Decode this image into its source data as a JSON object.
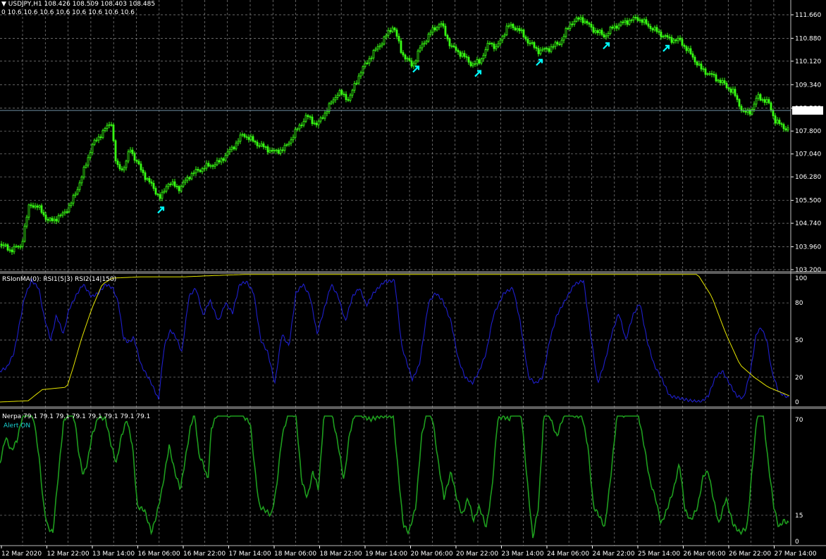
{
  "colors": {
    "background": "#000000",
    "grid": "#8a8a8a",
    "bull_candle": "#39ff14",
    "bear_candle": "#39ff14",
    "arrow": "#00ffff",
    "rsi1": "#1f1fcc",
    "rsi2": "#e6e600",
    "nerpa": "#1e9e1e",
    "price_line": "#6f8fa5",
    "axis_text": "#ffffff"
  },
  "main": {
    "symbol_header": "USDJPY,H1  108.426 108.509 108.403 108.485",
    "ma_values": "0 10.6 10.6 10.6 10.6 10.6 10.6 10.6 10.6",
    "current_price": "108.485",
    "price_ticks": [
      "111.660",
      "110.880",
      "110.120",
      "109.340",
      "108.560",
      "107.800",
      "107.040",
      "106.280",
      "105.500",
      "104.740",
      "103.960",
      "103.200"
    ]
  },
  "rsi_panel": {
    "label": "RSIonMA(0): RSI1(5|3) RSI2(14|150)",
    "ticks": [
      "100",
      "80",
      "50",
      "20",
      "0"
    ]
  },
  "nerpa_panel": {
    "label": "Nerpa 79.1 79.1 79.1 79.1 79.1 79.1 79.1 79.1",
    "alert": "Alert ON",
    "ticks": [
      "70",
      "15",
      "0"
    ]
  },
  "time_axis": {
    "labels": [
      "12 Mar 2020",
      "12 Mar 22:00",
      "13 Mar 14:00",
      "16 Mar 06:00",
      "16 Mar 22:00",
      "17 Mar 14:00",
      "18 Mar 06:00",
      "18 Mar 22:00",
      "19 Mar 14:00",
      "20 Mar 06:00",
      "20 Mar 22:00",
      "23 Mar 14:00",
      "24 Mar 06:00",
      "24 Mar 22:00",
      "25 Mar 14:00",
      "26 Mar 06:00",
      "26 Mar 22:00",
      "27 Mar 14:00"
    ]
  },
  "chart_data": {
    "type": "line",
    "title": "USDJPY,H1",
    "price_path_anchors": [
      [
        0,
        104.05
      ],
      [
        15,
        103.85
      ],
      [
        30,
        104.0
      ],
      [
        42,
        105.4
      ],
      [
        58,
        105.2
      ],
      [
        68,
        104.8
      ],
      [
        85,
        104.95
      ],
      [
        100,
        105.35
      ],
      [
        115,
        106.2
      ],
      [
        130,
        107.3
      ],
      [
        145,
        107.75
      ],
      [
        158,
        108.1
      ],
      [
        165,
        106.6
      ],
      [
        175,
        106.55
      ],
      [
        185,
        107.2
      ],
      [
        200,
        106.5
      ],
      [
        215,
        106.0
      ],
      [
        228,
        105.55
      ],
      [
        238,
        106.1
      ],
      [
        255,
        105.9
      ],
      [
        270,
        106.35
      ],
      [
        290,
        106.6
      ],
      [
        310,
        106.75
      ],
      [
        330,
        107.25
      ],
      [
        345,
        107.7
      ],
      [
        360,
        107.45
      ],
      [
        375,
        107.25
      ],
      [
        390,
        107.1
      ],
      [
        405,
        107.25
      ],
      [
        420,
        107.8
      ],
      [
        435,
        108.3
      ],
      [
        450,
        108.0
      ],
      [
        465,
        108.55
      ],
      [
        480,
        109.1
      ],
      [
        495,
        108.85
      ],
      [
        510,
        109.7
      ],
      [
        525,
        110.25
      ],
      [
        540,
        110.7
      ],
      [
        558,
        111.3
      ],
      [
        570,
        110.4
      ],
      [
        585,
        109.95
      ],
      [
        595,
        110.5
      ],
      [
        610,
        111.05
      ],
      [
        625,
        111.4
      ],
      [
        640,
        110.6
      ],
      [
        655,
        110.35
      ],
      [
        670,
        110.0
      ],
      [
        680,
        110.1
      ],
      [
        695,
        110.75
      ],
      [
        705,
        110.55
      ],
      [
        720,
        111.3
      ],
      [
        735,
        111.2
      ],
      [
        750,
        110.75
      ],
      [
        765,
        110.45
      ],
      [
        780,
        110.55
      ],
      [
        795,
        110.75
      ],
      [
        810,
        111.4
      ],
      [
        825,
        111.55
      ],
      [
        840,
        111.2
      ],
      [
        858,
        110.95
      ],
      [
        870,
        111.25
      ],
      [
        890,
        111.45
      ],
      [
        905,
        111.55
      ],
      [
        920,
        111.3
      ],
      [
        935,
        111.05
      ],
      [
        950,
        110.85
      ],
      [
        965,
        110.8
      ],
      [
        980,
        110.35
      ],
      [
        995,
        109.85
      ],
      [
        1010,
        109.65
      ],
      [
        1025,
        109.4
      ],
      [
        1040,
        109.1
      ],
      [
        1055,
        108.4
      ],
      [
        1065,
        108.45
      ],
      [
        1075,
        108.95
      ],
      [
        1090,
        108.75
      ],
      [
        1100,
        108.15
      ],
      [
        1110,
        107.95
      ],
      [
        1120,
        107.85
      ]
    ],
    "signal_arrows_x": [
      228,
      590,
      678,
      765,
      860,
      945
    ],
    "rsi1_anchors": [
      [
        0,
        25
      ],
      [
        10,
        28
      ],
      [
        20,
        40
      ],
      [
        35,
        85
      ],
      [
        45,
        98
      ],
      [
        55,
        92
      ],
      [
        62,
        70
      ],
      [
        72,
        50
      ],
      [
        80,
        70
      ],
      [
        90,
        55
      ],
      [
        98,
        75
      ],
      [
        110,
        88
      ],
      [
        118,
        95
      ],
      [
        130,
        85
      ],
      [
        140,
        88
      ],
      [
        150,
        95
      ],
      [
        160,
        92
      ],
      [
        168,
        80
      ],
      [
        175,
        52
      ],
      [
        182,
        48
      ],
      [
        190,
        52
      ],
      [
        200,
        30
      ],
      [
        215,
        15
      ],
      [
        225,
        2
      ],
      [
        233,
        45
      ],
      [
        242,
        58
      ],
      [
        250,
        52
      ],
      [
        258,
        40
      ],
      [
        268,
        85
      ],
      [
        278,
        92
      ],
      [
        288,
        70
      ],
      [
        298,
        82
      ],
      [
        310,
        65
      ],
      [
        320,
        80
      ],
      [
        330,
        72
      ],
      [
        340,
        95
      ],
      [
        350,
        97
      ],
      [
        360,
        88
      ],
      [
        370,
        50
      ],
      [
        380,
        40
      ],
      [
        390,
        15
      ],
      [
        400,
        55
      ],
      [
        410,
        45
      ],
      [
        420,
        88
      ],
      [
        430,
        95
      ],
      [
        440,
        85
      ],
      [
        450,
        55
      ],
      [
        460,
        75
      ],
      [
        470,
        95
      ],
      [
        480,
        85
      ],
      [
        490,
        65
      ],
      [
        500,
        85
      ],
      [
        510,
        92
      ],
      [
        520,
        78
      ],
      [
        530,
        88
      ],
      [
        545,
        97
      ],
      [
        560,
        98
      ],
      [
        570,
        45
      ],
      [
        585,
        18
      ],
      [
        595,
        30
      ],
      [
        608,
        80
      ],
      [
        618,
        88
      ],
      [
        628,
        82
      ],
      [
        640,
        65
      ],
      [
        650,
        35
      ],
      [
        660,
        20
      ],
      [
        670,
        15
      ],
      [
        680,
        25
      ],
      [
        690,
        40
      ],
      [
        700,
        70
      ],
      [
        715,
        88
      ],
      [
        728,
        92
      ],
      [
        738,
        65
      ],
      [
        750,
        20
      ],
      [
        760,
        15
      ],
      [
        770,
        20
      ],
      [
        780,
        50
      ],
      [
        790,
        70
      ],
      [
        800,
        80
      ],
      [
        815,
        95
      ],
      [
        828,
        98
      ],
      [
        838,
        55
      ],
      [
        848,
        15
      ],
      [
        858,
        32
      ],
      [
        868,
        55
      ],
      [
        878,
        72
      ],
      [
        888,
        50
      ],
      [
        898,
        70
      ],
      [
        908,
        80
      ],
      [
        918,
        50
      ],
      [
        928,
        30
      ],
      [
        938,
        20
      ],
      [
        950,
        5
      ],
      [
        965,
        3
      ],
      [
        980,
        1
      ],
      [
        995,
        0
      ],
      [
        1005,
        5
      ],
      [
        1015,
        20
      ],
      [
        1025,
        25
      ],
      [
        1035,
        15
      ],
      [
        1045,
        5
      ],
      [
        1055,
        3
      ],
      [
        1065,
        25
      ],
      [
        1073,
        55
      ],
      [
        1080,
        60
      ],
      [
        1088,
        50
      ],
      [
        1095,
        25
      ],
      [
        1105,
        8
      ],
      [
        1120,
        3
      ]
    ],
    "rsi2_anchors": [
      [
        0,
        0
      ],
      [
        40,
        1
      ],
      [
        60,
        10
      ],
      [
        95,
        12
      ],
      [
        105,
        30
      ],
      [
        115,
        50
      ],
      [
        130,
        75
      ],
      [
        145,
        95
      ],
      [
        160,
        100
      ],
      [
        200,
        101
      ],
      [
        260,
        101
      ],
      [
        300,
        102
      ],
      [
        350,
        103
      ],
      [
        990,
        103
      ],
      [
        1010,
        85
      ],
      [
        1030,
        55
      ],
      [
        1050,
        30
      ],
      [
        1070,
        20
      ],
      [
        1090,
        12
      ],
      [
        1120,
        5
      ]
    ],
    "nerpa_anchors": [
      [
        0,
        45
      ],
      [
        8,
        60
      ],
      [
        16,
        52
      ],
      [
        24,
        58
      ],
      [
        32,
        72
      ],
      [
        40,
        75
      ],
      [
        48,
        70
      ],
      [
        55,
        50
      ],
      [
        62,
        20
      ],
      [
        68,
        8
      ],
      [
        75,
        5
      ],
      [
        82,
        35
      ],
      [
        90,
        68
      ],
      [
        98,
        75
      ],
      [
        106,
        70
      ],
      [
        112,
        50
      ],
      [
        118,
        38
      ],
      [
        124,
        45
      ],
      [
        130,
        60
      ],
      [
        140,
        72
      ],
      [
        150,
        70
      ],
      [
        158,
        55
      ],
      [
        165,
        45
      ],
      [
        172,
        60
      ],
      [
        180,
        70
      ],
      [
        188,
        55
      ],
      [
        195,
        20
      ],
      [
        205,
        18
      ],
      [
        215,
        5
      ],
      [
        222,
        15
      ],
      [
        230,
        30
      ],
      [
        240,
        55
      ],
      [
        248,
        40
      ],
      [
        256,
        30
      ],
      [
        262,
        45
      ],
      [
        270,
        65
      ],
      [
        276,
        75
      ],
      [
        282,
        50
      ],
      [
        288,
        45
      ],
      [
        295,
        35
      ],
      [
        300,
        65
      ],
      [
        310,
        75
      ],
      [
        318,
        75
      ],
      [
        325,
        72
      ],
      [
        335,
        76
      ],
      [
        345,
        72
      ],
      [
        355,
        68
      ],
      [
        362,
        40
      ],
      [
        368,
        20
      ],
      [
        376,
        18
      ],
      [
        385,
        15
      ],
      [
        392,
        30
      ],
      [
        400,
        60
      ],
      [
        410,
        75
      ],
      [
        420,
        72
      ],
      [
        428,
        35
      ],
      [
        436,
        25
      ],
      [
        444,
        40
      ],
      [
        452,
        30
      ],
      [
        460,
        75
      ],
      [
        470,
        75
      ],
      [
        480,
        55
      ],
      [
        488,
        35
      ],
      [
        496,
        62
      ],
      [
        505,
        75
      ],
      [
        515,
        72
      ],
      [
        525,
        70
      ],
      [
        540,
        72
      ],
      [
        558,
        72
      ],
      [
        565,
        40
      ],
      [
        572,
        10
      ],
      [
        580,
        5
      ],
      [
        590,
        20
      ],
      [
        598,
        60
      ],
      [
        606,
        75
      ],
      [
        614,
        70
      ],
      [
        622,
        45
      ],
      [
        630,
        25
      ],
      [
        640,
        40
      ],
      [
        648,
        25
      ],
      [
        656,
        15
      ],
      [
        664,
        25
      ],
      [
        672,
        12
      ],
      [
        680,
        20
      ],
      [
        690,
        8
      ],
      [
        698,
        30
      ],
      [
        706,
        70
      ],
      [
        714,
        72
      ],
      [
        722,
        70
      ],
      [
        730,
        75
      ],
      [
        740,
        72
      ],
      [
        748,
        35
      ],
      [
        756,
        2
      ],
      [
        764,
        20
      ],
      [
        772,
        75
      ],
      [
        780,
        72
      ],
      [
        790,
        60
      ],
      [
        798,
        70
      ],
      [
        806,
        75
      ],
      [
        816,
        72
      ],
      [
        826,
        72
      ],
      [
        834,
        55
      ],
      [
        842,
        20
      ],
      [
        850,
        15
      ],
      [
        858,
        8
      ],
      [
        866,
        35
      ],
      [
        876,
        75
      ],
      [
        886,
        72
      ],
      [
        896,
        75
      ],
      [
        906,
        72
      ],
      [
        914,
        55
      ],
      [
        922,
        35
      ],
      [
        930,
        25
      ],
      [
        938,
        10
      ],
      [
        946,
        18
      ],
      [
        956,
        30
      ],
      [
        964,
        45
      ],
      [
        972,
        18
      ],
      [
        980,
        12
      ],
      [
        990,
        20
      ],
      [
        998,
        38
      ],
      [
        1005,
        40
      ],
      [
        1012,
        25
      ],
      [
        1020,
        10
      ],
      [
        1030,
        25
      ],
      [
        1040,
        10
      ],
      [
        1050,
        5
      ],
      [
        1060,
        8
      ],
      [
        1068,
        45
      ],
      [
        1075,
        75
      ],
      [
        1083,
        72
      ],
      [
        1090,
        45
      ],
      [
        1098,
        20
      ],
      [
        1105,
        8
      ],
      [
        1112,
        12
      ],
      [
        1120,
        10
      ]
    ]
  }
}
